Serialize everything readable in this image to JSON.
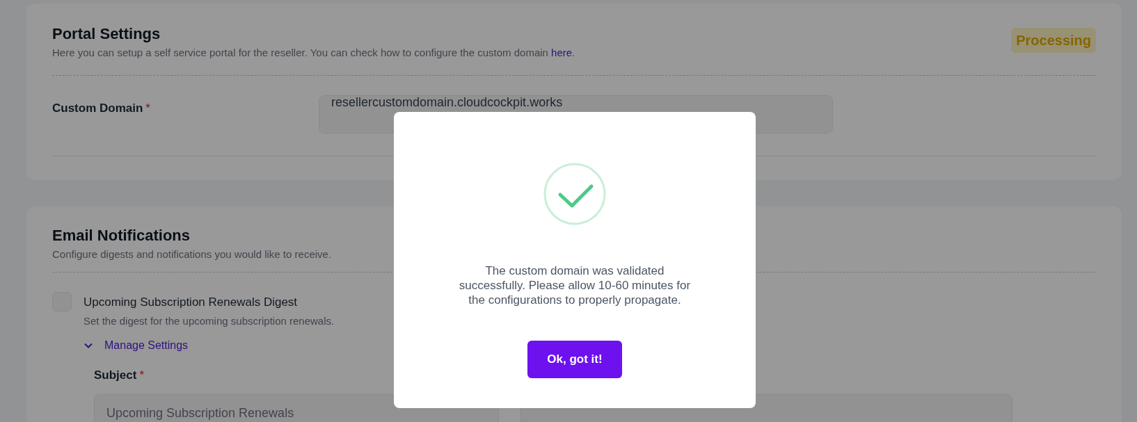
{
  "portal_settings": {
    "title": "Portal Settings",
    "description": "Here you can setup a self service portal for the reseller. You can check how to configure the custom domain ",
    "link": "here",
    "description_end": ".",
    "status": "Processing",
    "field": {
      "label": "Custom Domain",
      "required_mark": "*",
      "value": "resellercustomdomain.cloudcockpit.works"
    }
  },
  "email_notifications": {
    "title": "Email Notifications",
    "description": "Configure digests and notifications you would like to receive.",
    "items": [
      {
        "label": "Upcoming Subscription Renewals Digest",
        "description": "Set the digest for the upcoming subscription renewals.",
        "checked": false,
        "expanded": true,
        "toggle_label": "Manage Settings",
        "fields": [
          {
            "label": "Subject",
            "required_mark": "*",
            "value": "Upcoming Subscription Renewals"
          }
        ]
      }
    ]
  },
  "dialog": {
    "message": "The custom domain was validated successfully. Please allow 10-60 minutes for the configurations to properly propagate.",
    "button": "Ok, got it!"
  }
}
